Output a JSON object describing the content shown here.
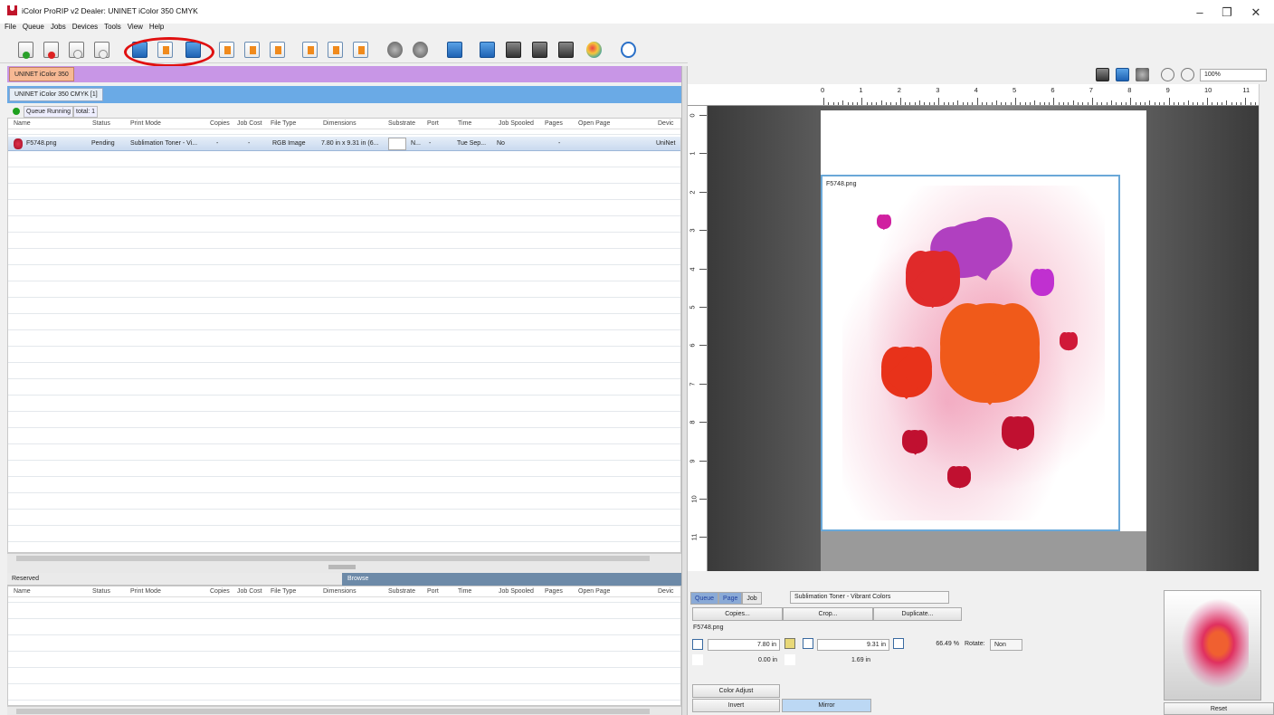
{
  "window": {
    "title": "iColor ProRIP v2 Dealer: UNINET iColor 350 CMYK",
    "minimize": "–",
    "maximize": "❐",
    "close": "✕"
  },
  "menu": [
    "File",
    "Queue",
    "Jobs",
    "Devices",
    "Tools",
    "View",
    "Help"
  ],
  "tabs": {
    "printer": "UNINET iColor 350",
    "queue": "UNINET iColor 350 CMYK [1]"
  },
  "queue_status": {
    "state": "Queue Running",
    "total": "total: 1"
  },
  "columns": [
    "Name",
    "Status",
    "Print Mode",
    "Copies",
    "Job Cost",
    "File Type",
    "Dimensions",
    "Substrate",
    "Port",
    "Time",
    "Job Spooled",
    "Pages",
    "Open Page",
    "Devic"
  ],
  "job": {
    "name": "F5748.png",
    "status": "Pending",
    "print_mode": "Sublimation Toner - Vi...",
    "copies": "-",
    "job_cost": "-",
    "file_type": "RGB Image",
    "dimensions": "7.80 in x 9.31 in (6...",
    "substrate": "N...",
    "port": "-",
    "time": "Tue Sep...",
    "job_spooled": "No",
    "pages": "-",
    "device": "UniNet"
  },
  "lower": {
    "reserved": "Reserved",
    "browse": "Browse"
  },
  "preview": {
    "zoom": "100%",
    "image_label": "F5748.png",
    "ruler_h": [
      "0",
      "1",
      "2",
      "3",
      "4",
      "5",
      "6",
      "7",
      "8",
      "9",
      "10",
      "11"
    ],
    "ruler_v": [
      "0",
      "1",
      "2",
      "3",
      "4",
      "5",
      "6",
      "7",
      "8",
      "9",
      "10",
      "11"
    ]
  },
  "props": {
    "tabs": [
      "Queue",
      "Page",
      "Job"
    ],
    "print_mode": "Sublimation Toner - Vibrant Colors",
    "copies_btn": "Copies...",
    "crop_btn": "Crop...",
    "duplicate_btn": "Duplicate...",
    "filename": "F5748.png",
    "width": "7.80 in",
    "height": "9.31 in",
    "scale": "66.49 %",
    "rotate_label": "Rotate:",
    "rotate_value": "Non",
    "x_offset": "0.00 in",
    "y_offset": "1.69 in",
    "color_adjust": "Color Adjust",
    "invert": "Invert",
    "mirror": "Mirror",
    "reset": "Reset"
  },
  "colors": {
    "accent": "#6aaae6",
    "printer_tab": "#c896e6",
    "highlight": "#e01010"
  }
}
